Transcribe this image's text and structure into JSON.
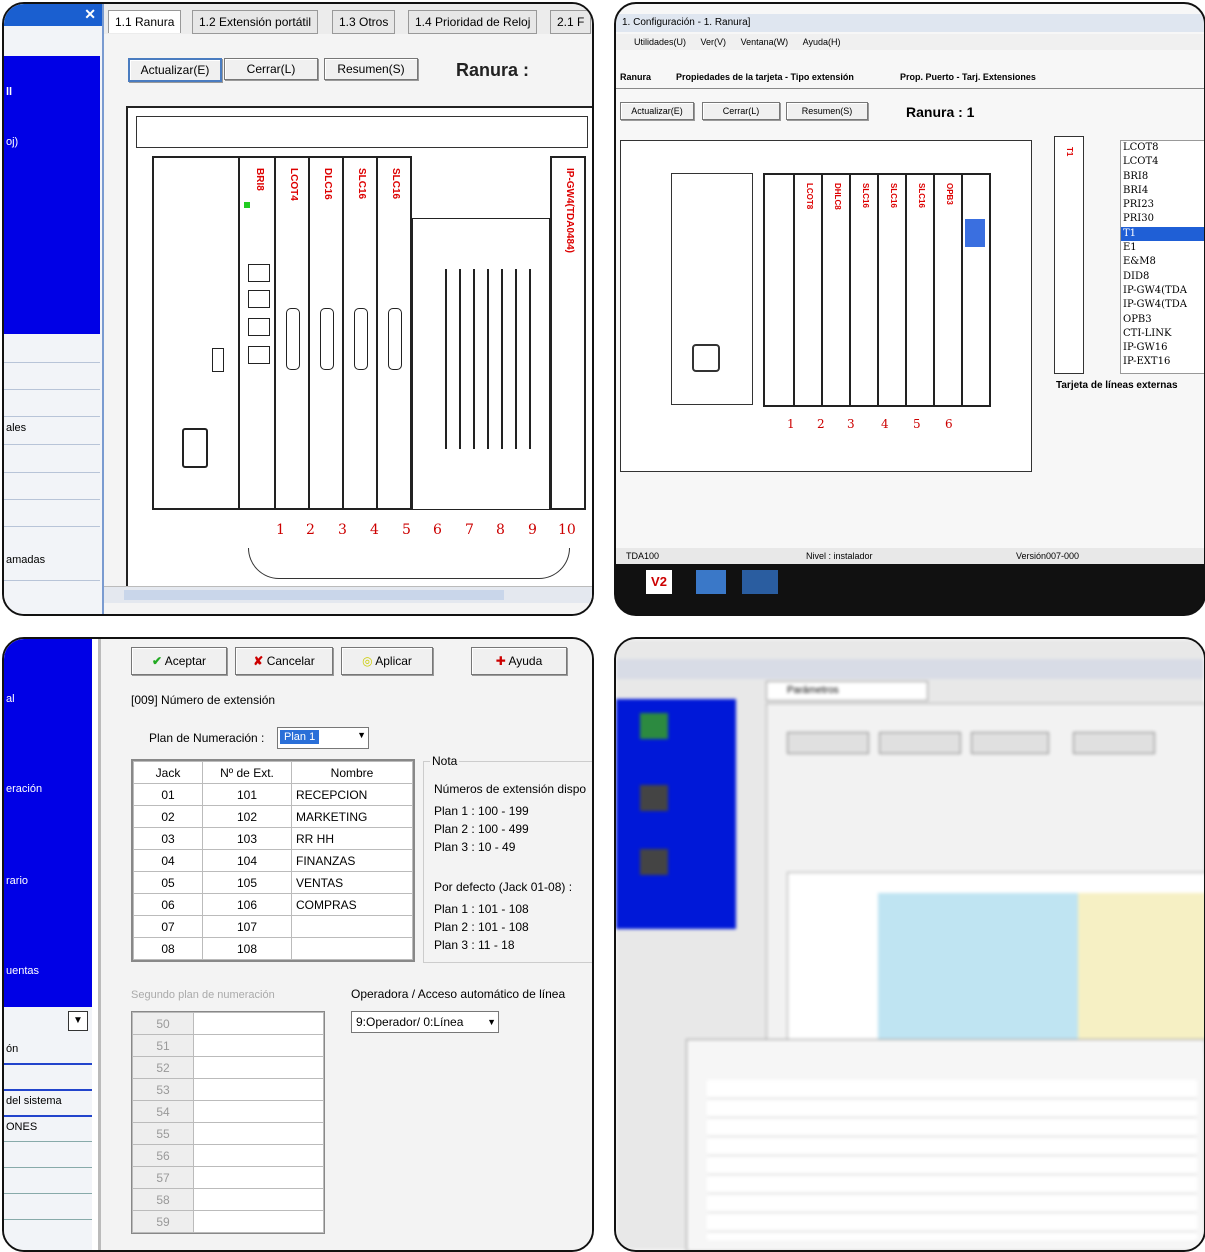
{
  "p1": {
    "tabs": [
      "1.1 Ranura",
      "1.2 Extensión portátil",
      "1.3 Otros",
      "1.4 Prioridad de Reloj",
      "2.1 F"
    ],
    "buttons": {
      "update": "Actualizar(E)",
      "close": "Cerrar(L)",
      "summary": "Resumen(S)"
    },
    "title": "Ranura :",
    "sidebar": [
      "ll",
      "oj)",
      "ales",
      "amadas"
    ],
    "cards": [
      "BRI8",
      "LCOT4",
      "DLC16",
      "SLC16",
      "SLC16",
      "IP-GW4(TDA0484)"
    ],
    "slot_numbers": [
      "1",
      "2",
      "3",
      "4",
      "5",
      "6",
      "7",
      "8",
      "9",
      "10"
    ],
    "close_x": "✕"
  },
  "p2": {
    "window_title": "1. Configuración - 1. Ranura]",
    "menu": [
      "Utilidades(U)",
      "Ver(V)",
      "Ventana(W)",
      "Ayuda(H)"
    ],
    "tabs": [
      "Ranura",
      "Propiedades de la tarjeta - Tipo extensión",
      "Prop. Puerto - Tarj. Extensiones"
    ],
    "buttons": {
      "update": "Actualizar(E)",
      "close": "Cerrar(L)",
      "summary": "Resumen(S)"
    },
    "title": "Ranura : 1",
    "card_types": [
      "LCOT8",
      "LCOT4",
      "BRI8",
      "BRI4",
      "PRI23",
      "PRI30",
      "T1",
      "E1",
      "E&M8",
      "DID8",
      "IP-GW4(TDA",
      "IP-GW4(TDA",
      "OPB3",
      "CTI-LINK",
      "IP-GW16",
      "IP-EXT16"
    ],
    "selected_card": "T1",
    "description": "Tarjeta de líneas externas",
    "card_labels": [
      "LCOT8",
      "DHLC8",
      "SLC16",
      "SLC16",
      "SLC16",
      "OPB3",
      "T1"
    ],
    "slot_numbers": [
      "1",
      "2",
      "3",
      "4",
      "5",
      "6"
    ],
    "status": [
      "TDA100",
      "Nivel : instalador",
      "Versión007-000"
    ],
    "taskbar": [
      "V2"
    ]
  },
  "p3": {
    "buttons": {
      "accept": "Aceptar",
      "cancel": "Cancelar",
      "apply": "Aplicar",
      "help": "Ayuda"
    },
    "heading": "[009] Número de extensión",
    "plan_label": "Plan de Numeración :",
    "plan_value": "Plan 1",
    "table_headers": [
      "Jack",
      "Nº de Ext.",
      "Nombre"
    ],
    "rows": [
      {
        "jack": "01",
        "ext": "101",
        "name": "RECEPCION"
      },
      {
        "jack": "02",
        "ext": "102",
        "name": "MARKETING"
      },
      {
        "jack": "03",
        "ext": "103",
        "name": "RR HH"
      },
      {
        "jack": "04",
        "ext": "104",
        "name": "FINANZAS"
      },
      {
        "jack": "05",
        "ext": "105",
        "name": "VENTAS"
      },
      {
        "jack": "06",
        "ext": "106",
        "name": "COMPRAS"
      },
      {
        "jack": "07",
        "ext": "107",
        "name": ""
      },
      {
        "jack": "08",
        "ext": "108",
        "name": ""
      }
    ],
    "note_title": "Nota",
    "note_heading": "Números de extensión dispo",
    "note_plans": [
      "Plan 1 : 100 - 199",
      "Plan 2 : 100 - 499",
      "Plan 3 :  10 - 49"
    ],
    "default_heading": "Por defecto (Jack 01-08) :",
    "default_plans": [
      "Plan 1 : 101 - 108",
      "Plan 2 : 101 - 108",
      "Plan 3 :  11 - 18"
    ],
    "second_plan_label": "Segundo plan de numeración",
    "second_plan_rows": [
      "50",
      "51",
      "52",
      "53",
      "54",
      "55",
      "56",
      "57",
      "58",
      "59"
    ],
    "operator_label": "Operadora / Acceso automático de línea",
    "operator_value": "9:Operador/ 0:Línea",
    "sidebar": [
      "al",
      "eración",
      "rario",
      "uentas",
      "ón",
      "del sistema",
      "ONES"
    ]
  },
  "p4": {
    "tab": "Parámetros"
  }
}
